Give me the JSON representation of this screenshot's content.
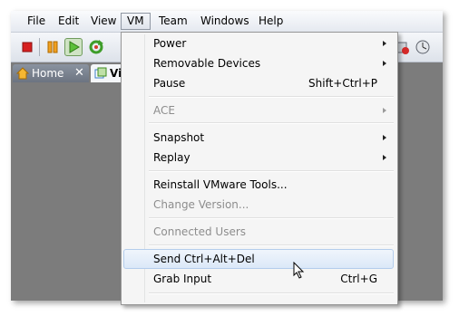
{
  "menubar": {
    "items": [
      {
        "label": "File"
      },
      {
        "label": "Edit"
      },
      {
        "label": "View"
      },
      {
        "label": "VM"
      },
      {
        "label": "Team"
      },
      {
        "label": "Windows"
      },
      {
        "label": "Help"
      }
    ]
  },
  "tabs": [
    {
      "label": "Home"
    },
    {
      "label": "Vi"
    }
  ],
  "vm_menu": {
    "items": [
      {
        "label": "Power",
        "shortcut": ""
      },
      {
        "label": "Removable Devices",
        "shortcut": ""
      },
      {
        "label": "Pause",
        "shortcut": "Shift+Ctrl+P"
      },
      {
        "label": "ACE",
        "shortcut": ""
      },
      {
        "label": "Snapshot",
        "shortcut": ""
      },
      {
        "label": "Replay",
        "shortcut": ""
      },
      {
        "label": "Reinstall VMware Tools...",
        "shortcut": ""
      },
      {
        "label": "Change Version...",
        "shortcut": ""
      },
      {
        "label": "Connected Users",
        "shortcut": ""
      },
      {
        "label": "Send Ctrl+Alt+Del",
        "shortcut": ""
      },
      {
        "label": "Grab Input",
        "shortcut": "Ctrl+G"
      }
    ]
  },
  "colors": {
    "window_bg": "#7c7c7c",
    "menu_bg": "#f5f5f5",
    "hover_bg": "#dbe8f8",
    "disabled_text": "#8d8d8d"
  }
}
